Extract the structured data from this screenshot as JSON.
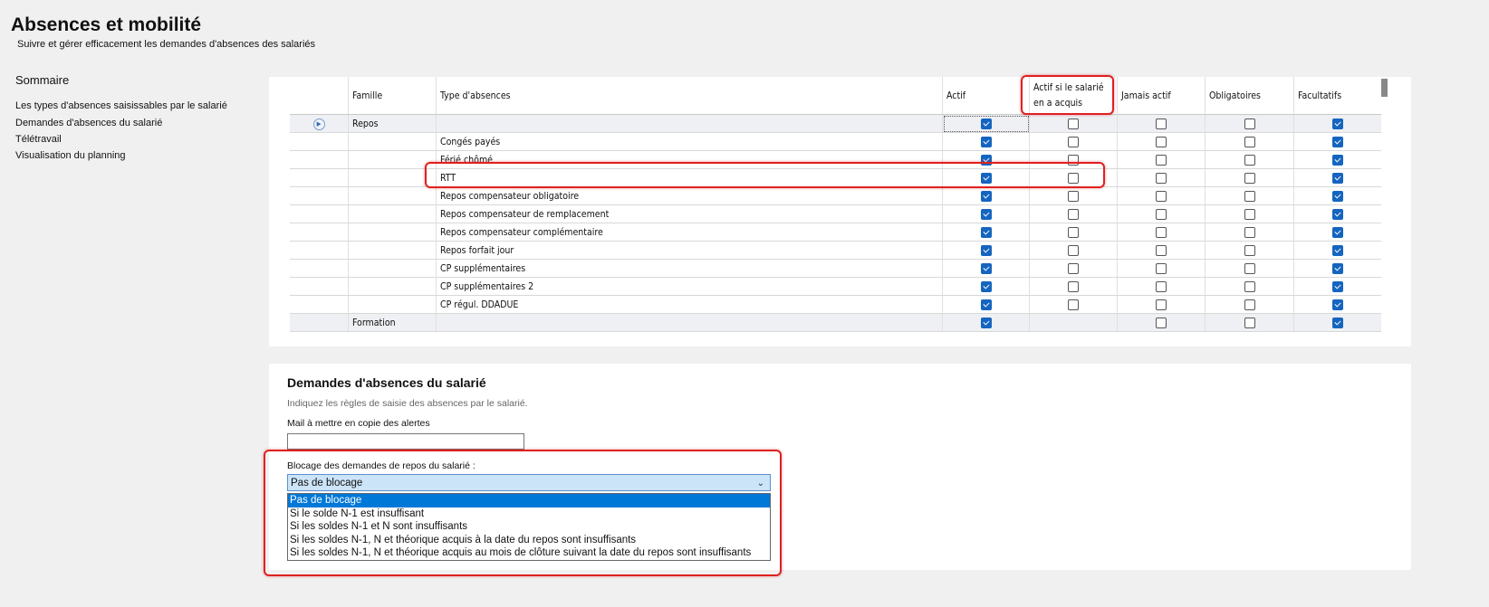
{
  "header": {
    "title": "Absences et mobilité",
    "subtitle": "Suivre et gérer efficacement les demandes d'absences des salariés"
  },
  "sidebar": {
    "title": "Sommaire",
    "items": [
      {
        "label": "Les types d'absences saisissables par le salarié"
      },
      {
        "label": "Demandes d'absences du salarié"
      },
      {
        "label": "Télétravail"
      },
      {
        "label": "Visualisation du planning"
      }
    ]
  },
  "table": {
    "columns": [
      "Famille",
      "Type d'absences",
      "Actif",
      "Actif si le salarié en a acquis",
      "Jamais actif",
      "Obligatoires",
      "Facultatifs"
    ],
    "rows": [
      {
        "famille": "Repos",
        "type": "",
        "group": true,
        "checks": [
          true,
          false,
          false,
          false,
          true
        ]
      },
      {
        "famille": "",
        "type": "Congés payés",
        "checks": [
          true,
          false,
          false,
          false,
          true
        ]
      },
      {
        "famille": "",
        "type": "Férié chômé",
        "checks": [
          true,
          false,
          false,
          false,
          true
        ]
      },
      {
        "famille": "",
        "type": "RTT",
        "checks": [
          true,
          false,
          false,
          false,
          true
        ]
      },
      {
        "famille": "",
        "type": "Repos compensateur obligatoire",
        "checks": [
          true,
          false,
          false,
          false,
          true
        ]
      },
      {
        "famille": "",
        "type": "Repos compensateur de remplacement",
        "checks": [
          true,
          false,
          false,
          false,
          true
        ]
      },
      {
        "famille": "",
        "type": "Repos compensateur complémentaire",
        "checks": [
          true,
          false,
          false,
          false,
          true
        ]
      },
      {
        "famille": "",
        "type": "Repos forfait jour",
        "checks": [
          true,
          false,
          false,
          false,
          true
        ]
      },
      {
        "famille": "",
        "type": "CP supplémentaires",
        "checks": [
          true,
          false,
          false,
          false,
          true
        ]
      },
      {
        "famille": "",
        "type": "CP supplémentaires 2",
        "checks": [
          true,
          false,
          false,
          false,
          true
        ]
      },
      {
        "famille": "",
        "type": "CP régul. DDADUE",
        "checks": [
          true,
          false,
          false,
          false,
          true
        ]
      },
      {
        "famille": "Formation",
        "type": "",
        "group": true,
        "checks": [
          true,
          null,
          false,
          false,
          true
        ]
      }
    ]
  },
  "demandes": {
    "title": "Demandes d'absences du salarié",
    "description": "Indiquez les règles de saisie des absences par le salarié.",
    "mail_label": "Mail à mettre en copie des alertes",
    "mail_value": "",
    "blocage_label": "Blocage des demandes de repos du salarié :",
    "blocage_selected": "Pas de blocage",
    "blocage_options": [
      "Pas de blocage",
      "Si le solde N-1 est insuffisant",
      "Si les soldes N-1 et N sont insuffisants",
      "Si les soldes N-1, N et théorique acquis à la date du repos sont insuffisants",
      "Si les soldes N-1, N et théorique acquis au mois de clôture suivant la date du repos sont insuffisants"
    ]
  },
  "colors": {
    "accent": "#0078d7",
    "checkbox": "#1565c0",
    "highlight": "#e02020"
  }
}
